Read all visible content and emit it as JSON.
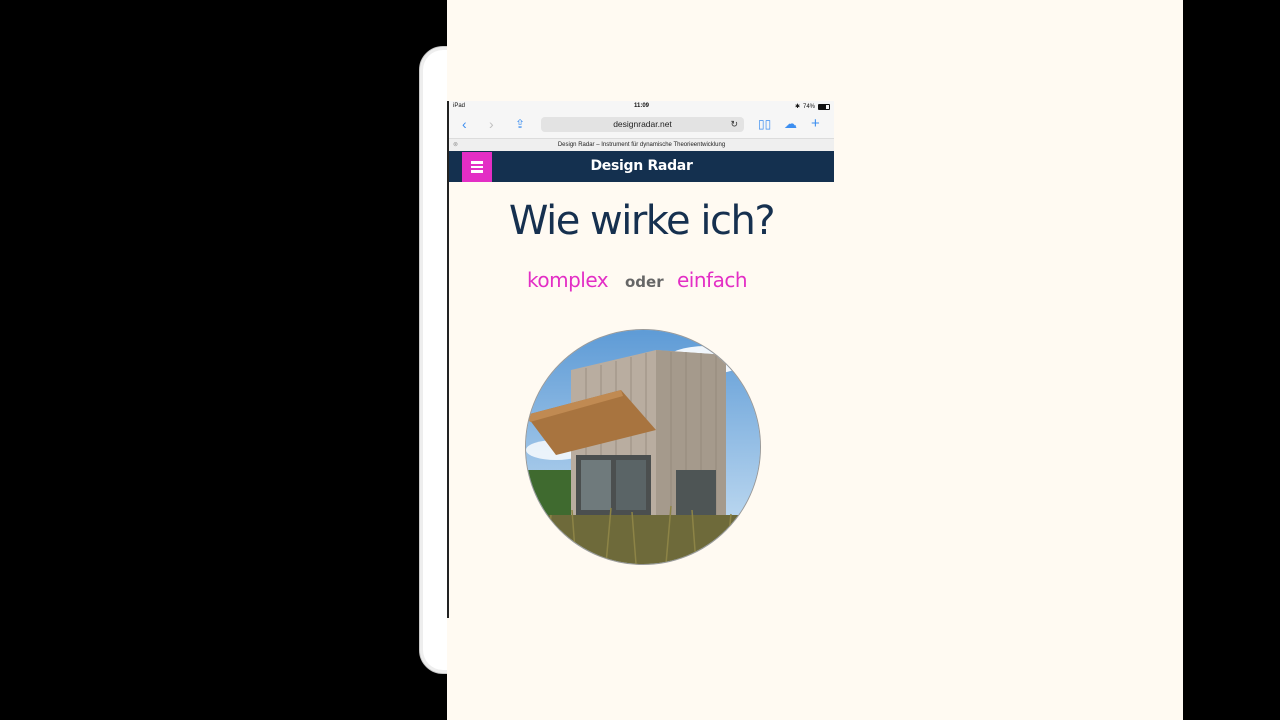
{
  "statusbar": {
    "device": "iPad",
    "time": "11:09",
    "battery": "74%"
  },
  "browser": {
    "url": "designradar.net",
    "tab_title": "Design Radar – Instrument für dynamische Theorieentwicklung"
  },
  "navbar": {
    "brand": "Design Radar"
  },
  "main": {
    "headline": "Wie wirke ich?",
    "choice_left": "komplex",
    "or_label": "oder",
    "choice_right": "einfach"
  },
  "icons": {
    "back": "chevron-left-icon",
    "forward": "chevron-right-icon",
    "share": "share-icon",
    "reload": "reload-icon",
    "bookmarks": "book-icon",
    "cloud": "cloud-icon",
    "add": "plus-icon",
    "menu": "hamburger-menu-icon"
  },
  "colors": {
    "navbar": "#14304f",
    "accent": "#e32ec5",
    "headline": "#16304f",
    "background": "#fffaf2"
  }
}
